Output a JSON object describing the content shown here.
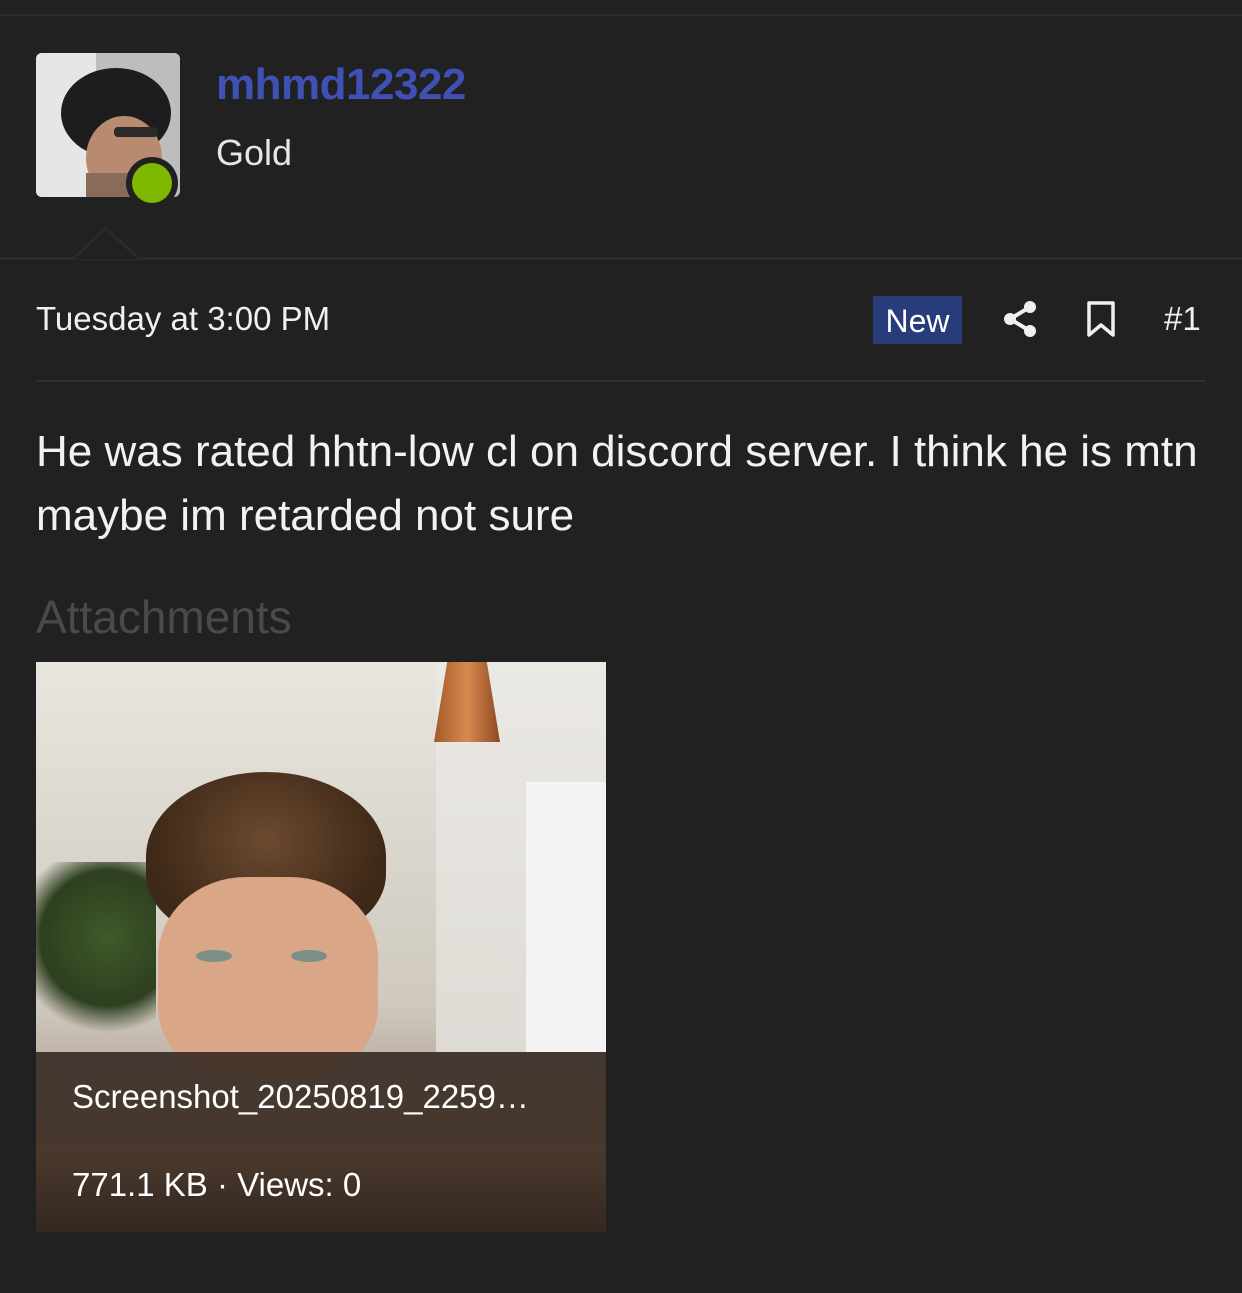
{
  "user": {
    "name": "mhmd12322",
    "title": "Gold",
    "online": true
  },
  "post": {
    "date": "Tuesday at 3:00 PM",
    "new_badge": "New",
    "number": "#1",
    "body": "He was rated hhtn-low cl on discord server. I think he is mtn maybe im retarded not sure"
  },
  "attachments": {
    "label": "Attachments",
    "items": [
      {
        "filename": "Screenshot_20250819_2259…",
        "meta": "771.1 KB · Views: 0"
      }
    ]
  },
  "colors": {
    "background": "#212121",
    "username": "#3f51b5",
    "new_badge": "#283b7a",
    "online": "#7fb800"
  },
  "icons": [
    "share-icon",
    "bookmark-icon"
  ]
}
